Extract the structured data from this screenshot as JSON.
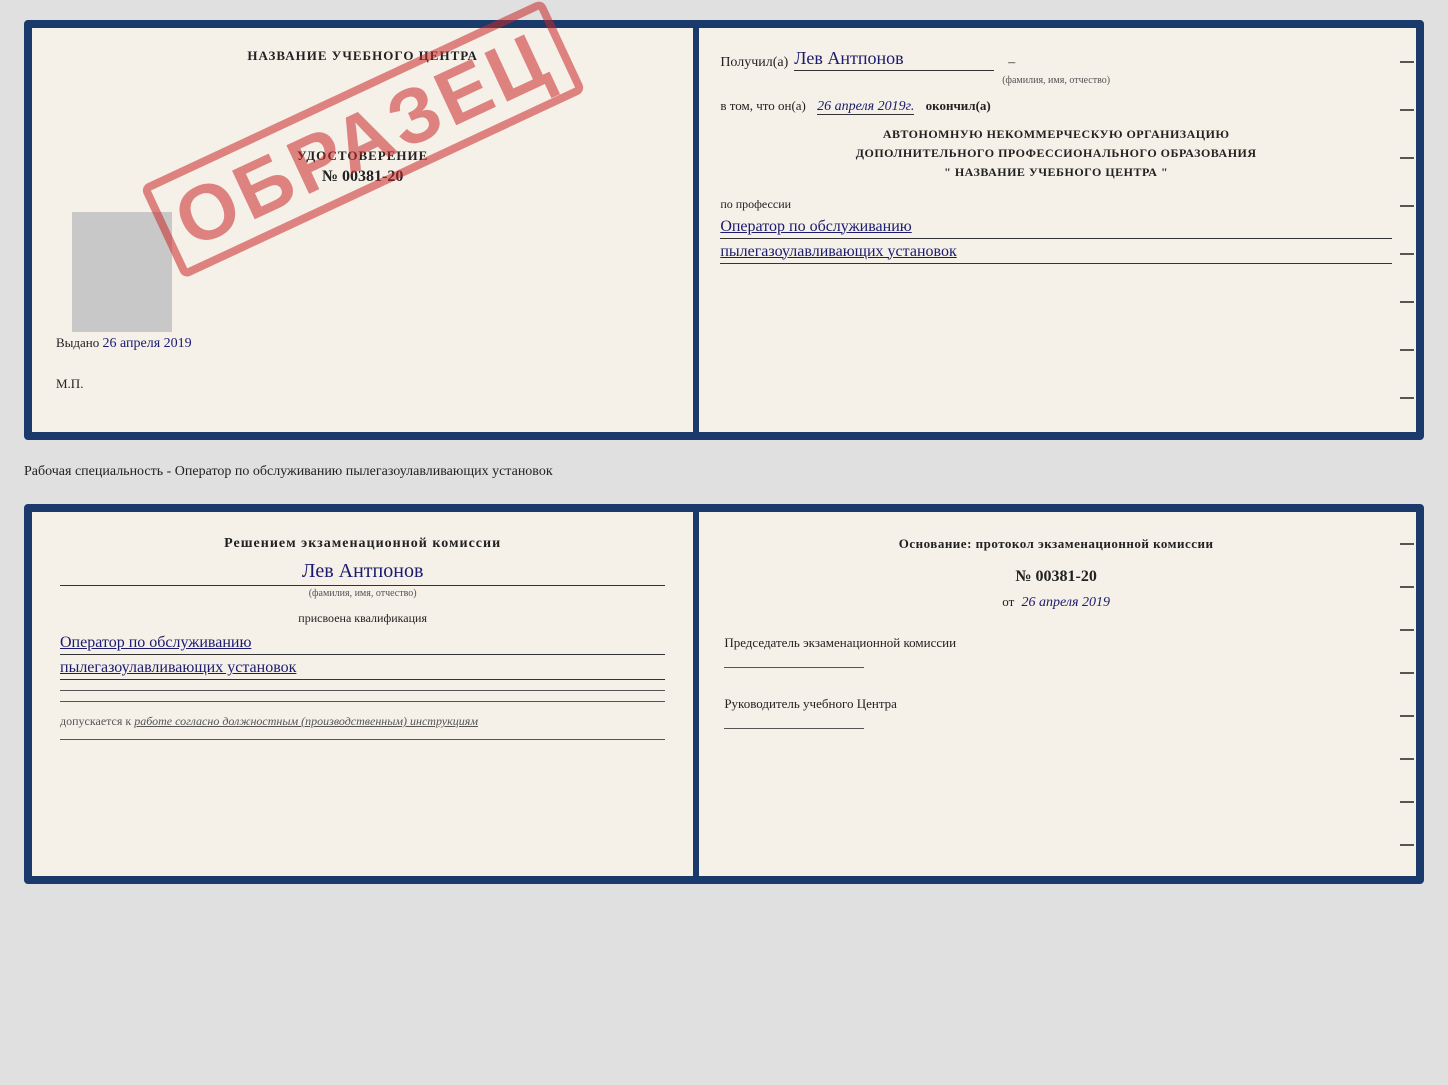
{
  "top_cert": {
    "left": {
      "title": "НАЗВАНИЕ УЧЕБНОГО ЦЕНТРА",
      "stamp": "ОБРАЗЕЦ",
      "udostoverenie": "УДОСТОВЕРЕНИЕ",
      "number": "№ 00381-20",
      "vydano_label": "Выдано",
      "vydano_date": "26 апреля 2019",
      "mp": "М.П."
    },
    "right": {
      "poluchil_label": "Получил(а)",
      "poluchil_name": "Лев Антпонов",
      "fio_sub": "(фамилия, имя, отчество)",
      "vtom_label": "в том, что он(а)",
      "vtom_date": "26 апреля 2019г.",
      "okonchill": "окончил(а)",
      "org_line1": "АВТОНОМНУЮ НЕКОММЕРЧЕСКУЮ ОРГАНИЗАЦИЮ",
      "org_line2": "ДОПОЛНИТЕЛЬНОГО ПРОФЕССИОНАЛЬНОГО ОБРАЗОВАНИЯ",
      "org_line3": "\"   НАЗВАНИЕ УЧЕБНОГО ЦЕНТРА   \"",
      "po_professii": "по профессии",
      "profession_line1": "Оператор по обслуживанию",
      "profession_line2": "пылегазоулавливающих установок"
    }
  },
  "separator": "Рабочая специальность - Оператор по обслуживанию пылегазоулавливающих установок",
  "bottom_cert": {
    "left": {
      "resheniem_label": "Решением экзаменационной комиссии",
      "name": "Лев Антпонов",
      "fio_sub": "(фамилия, имя, отчество)",
      "prisvoena": "присвоена квалификация",
      "qual_line1": "Оператор по обслуживанию",
      "qual_line2": "пылегазоулавливающих установок",
      "dopuskaetsya_label": "допускается к",
      "dopuskaetsya_text": "работе согласно должностным (производственным) инструкциям"
    },
    "right": {
      "osnovanie_label": "Основание: протокол экзаменационной комиссии",
      "protocol_number": "№  00381-20",
      "ot_label": "от",
      "ot_date": "26 апреля 2019",
      "predsedatel_label": "Председатель экзаменационной комиссии",
      "rukovoditel_label": "Руководитель учебного Центра"
    }
  }
}
